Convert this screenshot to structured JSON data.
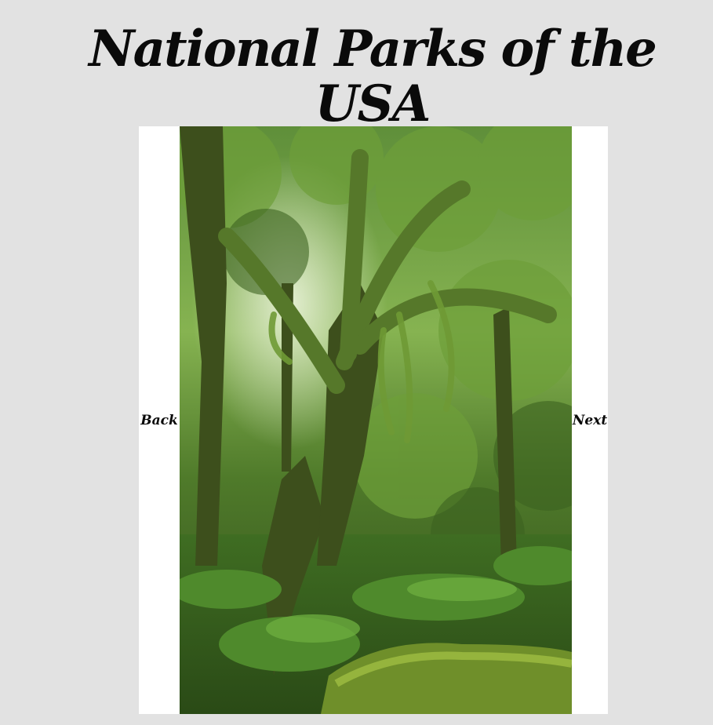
{
  "header": {
    "title": "National Parks of the USA"
  },
  "slider": {
    "back_label": "Back",
    "next_label": "Next",
    "image_description": "moss-covered rainforest trees and ferns"
  },
  "colors": {
    "page_background": "#e2e2e2",
    "slider_background": "#ffffff",
    "text": "#0a0a0a"
  }
}
